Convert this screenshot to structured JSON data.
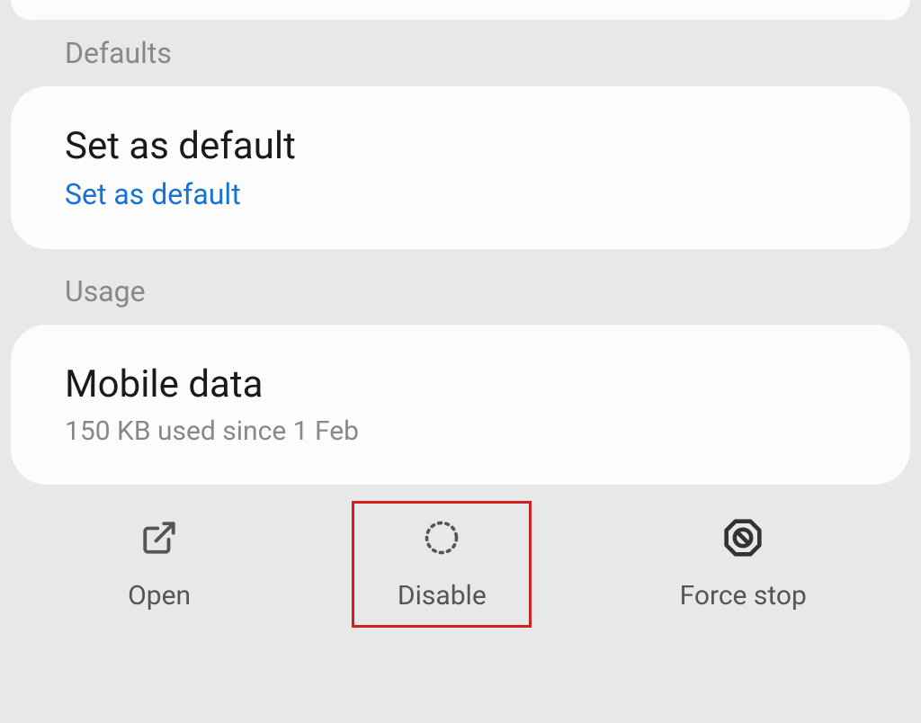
{
  "sections": {
    "defaults": {
      "header": "Defaults",
      "item": {
        "title": "Set as default",
        "subtitle": "Set as default"
      }
    },
    "usage": {
      "header": "Usage",
      "item": {
        "title": "Mobile data",
        "subtitle": "150 KB used since 1 Feb"
      }
    }
  },
  "actions": {
    "open": "Open",
    "disable": "Disable",
    "force_stop": "Force stop"
  }
}
